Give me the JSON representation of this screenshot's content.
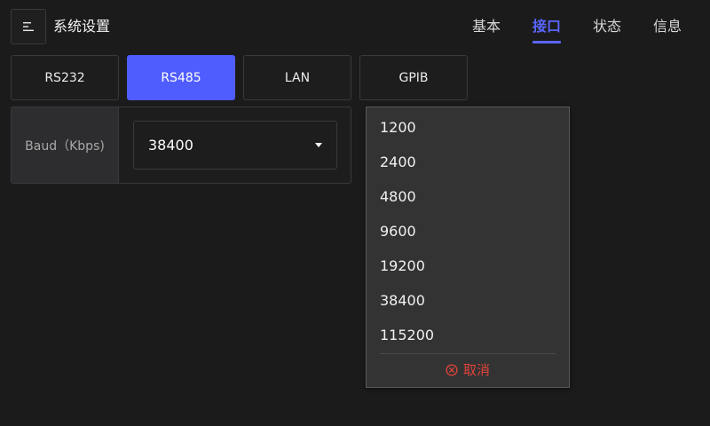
{
  "header": {
    "title": "系统设置",
    "tabs": [
      {
        "label": "基本",
        "active": false
      },
      {
        "label": "接口",
        "active": true
      },
      {
        "label": "状态",
        "active": false
      },
      {
        "label": "信息",
        "active": false
      }
    ]
  },
  "interfaces": {
    "tabs": [
      {
        "label": "RS232",
        "active": false
      },
      {
        "label": "RS485",
        "active": true
      },
      {
        "label": "LAN",
        "active": false
      },
      {
        "label": "GPIB",
        "active": false
      }
    ]
  },
  "setting": {
    "label": "Baud（Kbps)",
    "value": "38400"
  },
  "dropdown": {
    "options": [
      "1200",
      "2400",
      "4800",
      "9600",
      "19200",
      "38400",
      "115200"
    ],
    "cancel_label": "取消"
  },
  "colors": {
    "accent": "#4f5dff",
    "cancel": "#e0443a",
    "background": "#1b1b1c"
  },
  "icons": {
    "menu": "menu-icon",
    "caret": "caret-down-icon",
    "cancel": "cancel-circle-icon"
  }
}
